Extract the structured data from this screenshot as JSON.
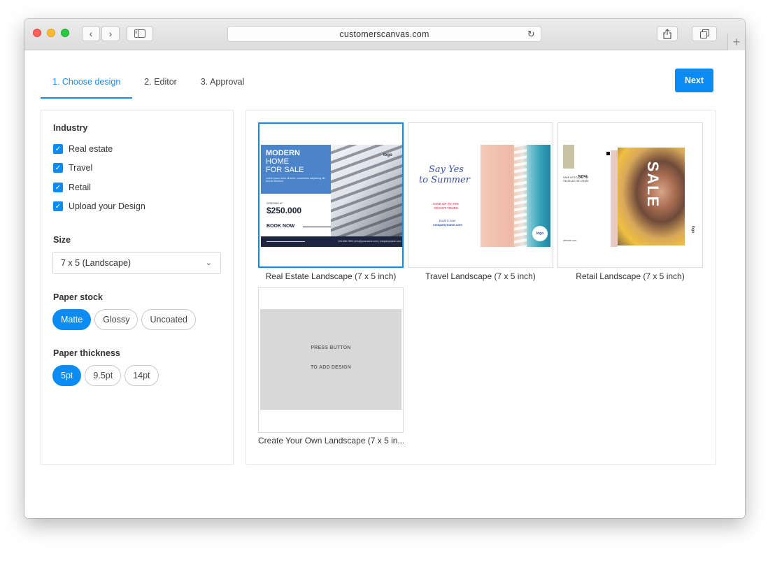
{
  "browser": {
    "url": "customerscanvas.com"
  },
  "tabs": [
    {
      "label": "1. Choose design",
      "active": true
    },
    {
      "label": "2. Editor",
      "active": false
    },
    {
      "label": "3. Approval",
      "active": false
    }
  ],
  "next_label": "Next",
  "filters": {
    "industry": {
      "title": "Industry",
      "options": [
        {
          "label": "Real estate",
          "checked": true
        },
        {
          "label": "Travel",
          "checked": true
        },
        {
          "label": "Retail",
          "checked": true
        },
        {
          "label": "Upload your Design",
          "checked": true
        }
      ]
    },
    "size": {
      "title": "Size",
      "selected": "7 x 5 (Landscape)"
    },
    "paper_stock": {
      "title": "Paper stock",
      "options": [
        "Matte",
        "Glossy",
        "Uncoated"
      ],
      "selected": "Matte"
    },
    "paper_thickness": {
      "title": "Paper thickness",
      "options": [
        "5pt",
        "9.5pt",
        "14pt"
      ],
      "selected": "5pt"
    }
  },
  "designs": [
    {
      "label": "Real Estate Landscape (7 x 5 inch)",
      "selected": true,
      "thumb": {
        "headline_1": "MODERN",
        "headline_2": "HOME",
        "headline_3": "FOR SALE",
        "body": "Lorem ipsum dolor sit amet, consectetur adipiscing elit, sed do eiusmod",
        "logo": "logo",
        "offering": "OFFERING AT",
        "price": "$250.000",
        "cta": "BOOK NOW",
        "footer": "123-456-7890 | info@yourname.com | companyname.com"
      }
    },
    {
      "label": "Travel Landscape (7 x 5 inch)",
      "selected": false,
      "thumb": {
        "title_1": "Say Yes",
        "title_2": "to Summer",
        "save_1": "SAVE UP TO 70%",
        "save_2": "ON HOT TOURS",
        "book_1": "book it now:",
        "book_2": "companyname.com",
        "logo": "logo"
      }
    },
    {
      "label": "Retail Landscape (7 x 5 inch)",
      "selected": false,
      "thumb": {
        "save_prefix": "SAVE UP TO",
        "save_value": "50%",
        "save_suffix": "ON SELECTED ITEMS",
        "sale": "SALE",
        "website": "website.com",
        "logo": "logo"
      }
    },
    {
      "label": "Create Your Own Landscape (7 x 5 in...",
      "selected": false,
      "thumb": {
        "line_1": "PRESS BUTTON",
        "line_2": "TO ADD DESIGN"
      }
    }
  ],
  "icons": {
    "back": "chevron-left-icon",
    "forward": "chevron-right-icon",
    "sidebar": "sidebar-icon",
    "reload": "reload-icon",
    "share": "share-icon",
    "tabs": "tabs-icon",
    "new_tab": "plus-icon",
    "check": "checkmark-icon",
    "dropdown": "chevron-down-icon"
  },
  "colors": {
    "accent": "#0b8cf5",
    "re_blue": "#4b84c8",
    "re_navy": "#1e2540"
  }
}
